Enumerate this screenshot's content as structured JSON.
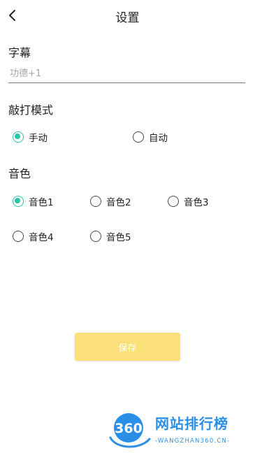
{
  "header": {
    "title": "设置"
  },
  "subtitle_section": {
    "label": "字幕",
    "input_value": "",
    "input_placeholder": "功德+1"
  },
  "tap_mode_section": {
    "label": "敲打模式",
    "options": [
      {
        "label": "手动",
        "checked": true
      },
      {
        "label": "自动",
        "checked": false
      }
    ]
  },
  "tone_section": {
    "label": "音色",
    "options": [
      {
        "label": "音色1",
        "checked": true
      },
      {
        "label": "音色2",
        "checked": false
      },
      {
        "label": "音色3",
        "checked": false
      },
      {
        "label": "音色4",
        "checked": false
      },
      {
        "label": "音色5",
        "checked": false
      }
    ]
  },
  "save_button": {
    "label": "保存"
  },
  "watermark": {
    "logo_text": "360",
    "name": "网站排行榜",
    "url": "-WANGZHAN360.CN-"
  },
  "colors": {
    "accent": "#2cc4a6",
    "button_bg": "#fbdf79",
    "watermark": "#2b8fe8"
  },
  "icons": {
    "back": "chevron-left-icon"
  }
}
